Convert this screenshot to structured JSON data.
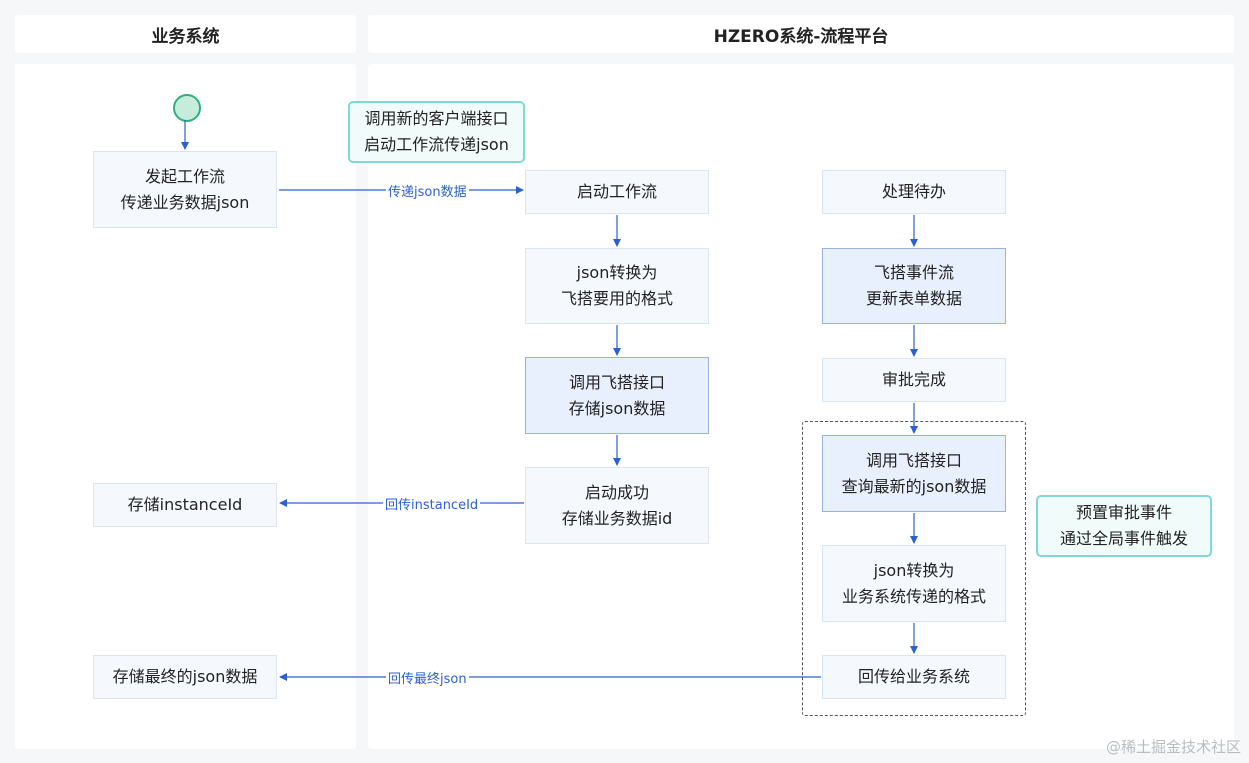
{
  "lanes": {
    "business": "业务系统",
    "platform": "HZERO系统-流程平台"
  },
  "nodes": {
    "start_workflow": "发起工作流\n传递业务数据json",
    "store_instance": "存储instanceId",
    "store_final_json": "存储最终的json数据",
    "launch_workflow": "启动工作流",
    "json_convert_feida": "json转换为\n飞搭要用的格式",
    "call_feida_store": "调用飞搭接口\n存储json数据",
    "launch_success": "启动成功\n存储业务数据id",
    "handle_todo": "处理待办",
    "feida_event_flow": "飞搭事件流\n更新表单数据",
    "approval_done": "审批完成",
    "call_feida_query": "调用飞搭接口\n查询最新的json数据",
    "json_convert_business": "json转换为\n业务系统传递的格式",
    "return_to_business": "回传给业务系统"
  },
  "notes": {
    "client_api": "调用新的客户端接口\n启动工作流传递json",
    "preset_event": "预置审批事件\n通过全局事件触发"
  },
  "edge_labels": {
    "pass_json": "传递json数据",
    "return_instance": "回传instanceId",
    "return_final_json": "回传最终json"
  },
  "watermark": "@稀土掘金技术社区"
}
